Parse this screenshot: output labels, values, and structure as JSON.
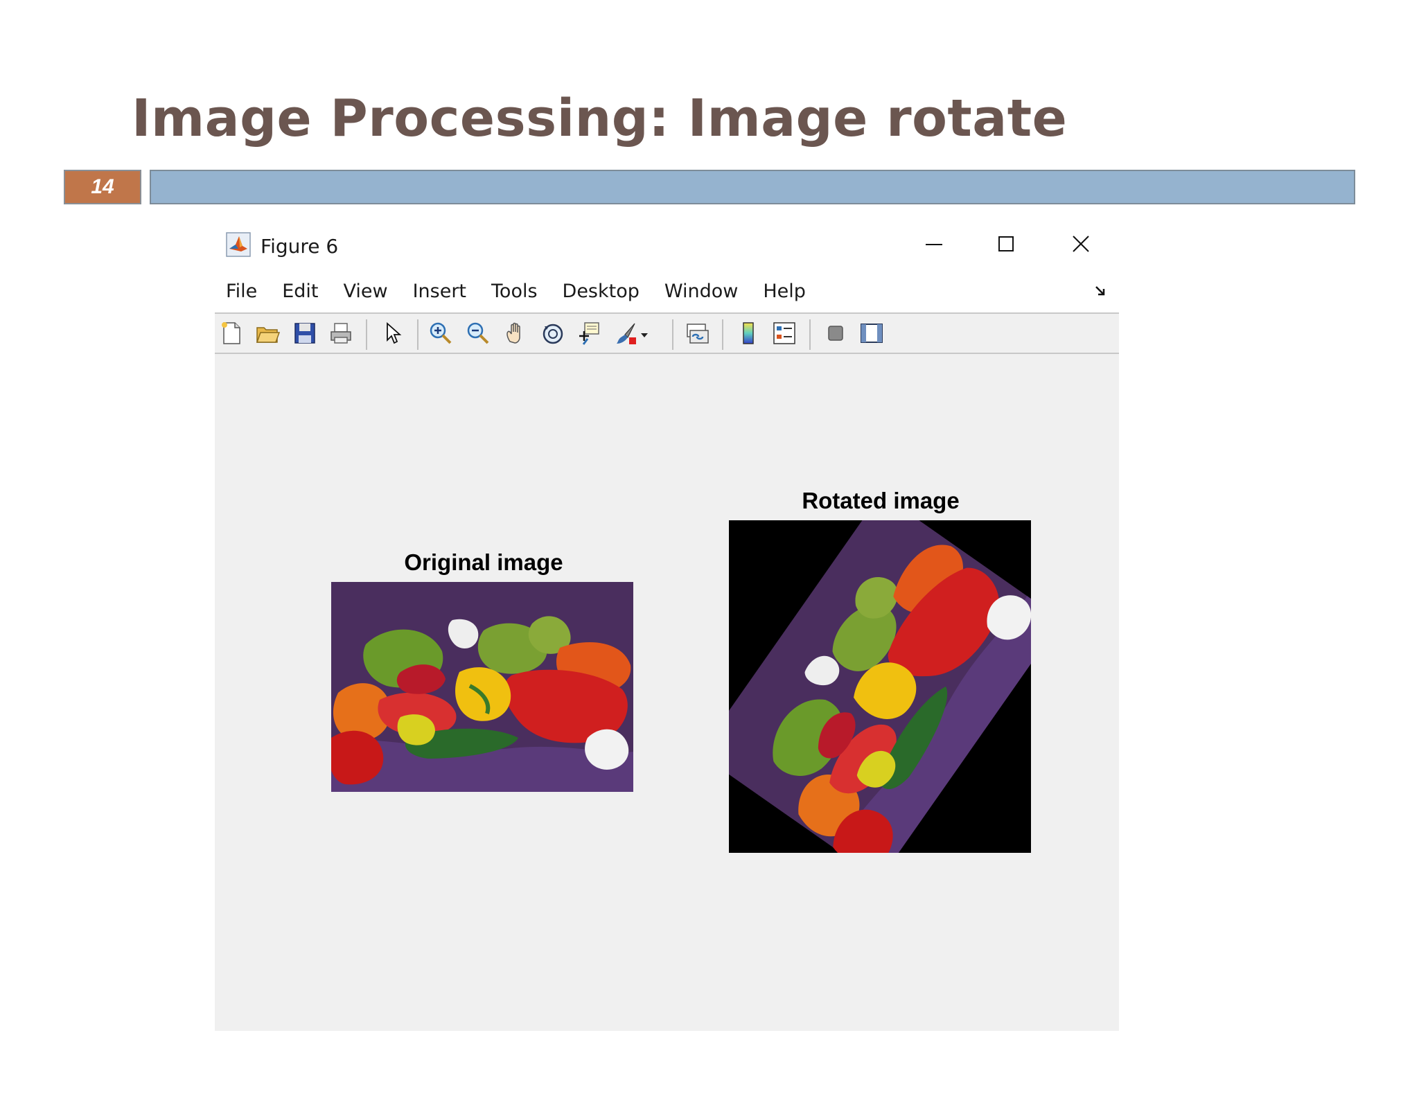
{
  "slide": {
    "title": "Image Processing: Image rotate",
    "number": "14"
  },
  "window": {
    "title": "Figure 6",
    "app_icon": "matlab-icon",
    "controls": [
      "minimize-icon",
      "maximize-icon",
      "close-icon"
    ]
  },
  "menu": [
    "File",
    "Edit",
    "View",
    "Insert",
    "Tools",
    "Desktop",
    "Window",
    "Help"
  ],
  "toolbar": [
    "new-figure-icon",
    "open-file-icon",
    "save-icon",
    "print-icon",
    "edit-plot-pointer-icon",
    "zoom-in-icon",
    "zoom-out-icon",
    "pan-icon",
    "rotate-3d-icon",
    "data-cursor-icon",
    "brush-icon",
    "link-plot-icon",
    "colorbar-icon",
    "legend-icon",
    "hide-plot-tools-icon",
    "show-plot-tools-icon"
  ],
  "axes": {
    "original": {
      "title": "Original image"
    },
    "rotated": {
      "title": "Rotated image"
    }
  },
  "colors": {
    "title_text": "#6b5650",
    "slide_number_bg": "#c0764a",
    "slide_bar": "#95b3cf",
    "figure_bg": "#f0f0f0",
    "cloth_purple": "#5a3a7a"
  }
}
